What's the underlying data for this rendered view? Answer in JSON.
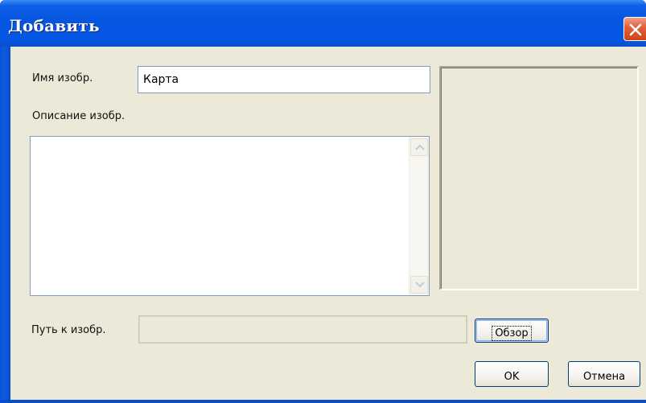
{
  "window": {
    "title": "Добавить",
    "close_icon": "close-icon",
    "accent_color": "#0a51d9",
    "close_color": "#e2613c"
  },
  "form": {
    "name_label": "Имя изобр.",
    "name_value": "Карта",
    "description_label": "Описание изобр.",
    "description_value": "",
    "path_label": "Путь к изобр.",
    "path_value": ""
  },
  "buttons": {
    "browse_label": "Обзор",
    "ok_label": "OK",
    "cancel_label": "Отмена"
  },
  "scrollbar": {
    "up_icon": "arrow-up-icon",
    "down_icon": "arrow-down-icon"
  }
}
